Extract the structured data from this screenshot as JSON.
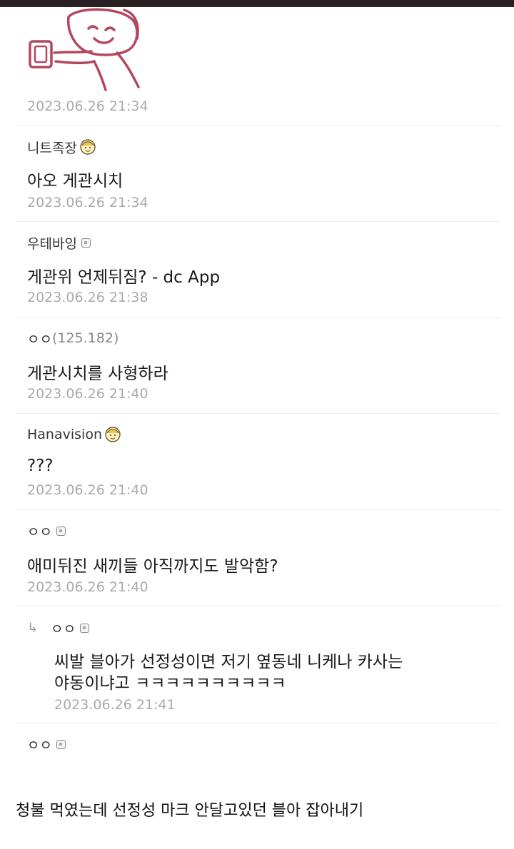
{
  "comments": [
    {
      "date": "2023.06.26 21:34"
    },
    {
      "author": "니트족장",
      "badge": "gonik-icon",
      "text": "아오 게관시치",
      "date": "2023.06.26 21:34"
    },
    {
      "author": "우테바잉",
      "badge": "fixed-nick-icon",
      "text": "게관위 언제뒤짐? - dc App",
      "date": "2023.06.26 21:38"
    },
    {
      "author": "ㅇㅇ",
      "ip": "(125.182)",
      "text": "게관시치를 사형하라",
      "date": "2023.06.26 21:40"
    },
    {
      "author": "Hanavision",
      "badge": "gonik-icon",
      "text": "???",
      "date": "2023.06.26 21:40"
    },
    {
      "author": "ㅇㅇ",
      "badge": "fixed-nick-icon",
      "text": "애미뒤진 새끼들 아직까지도 발악함?",
      "date": "2023.06.26 21:40"
    },
    {
      "reply_arrow": "↳",
      "author": "ㅇㅇ",
      "badge": "fixed-nick-icon",
      "text_line1": "씨발 블아가 선정성이면 저기 옆동네 니케나 카사는",
      "text_line2": "야동이냐고 ㅋㅋㅋㅋㅋㅋㅋㅋㅋㅋ",
      "date": "2023.06.26 21:41"
    },
    {
      "author": "ㅇㅇ",
      "badge": "fixed-nick-icon"
    }
  ],
  "caption": "청불 먹였는데 선정성 마크 안달고있던 블아 잡아내기",
  "colors": {
    "topbar": "#2a2222",
    "sticker_stroke": "#b3475e",
    "date": "#aaaaaa",
    "divider": "#ececec"
  }
}
